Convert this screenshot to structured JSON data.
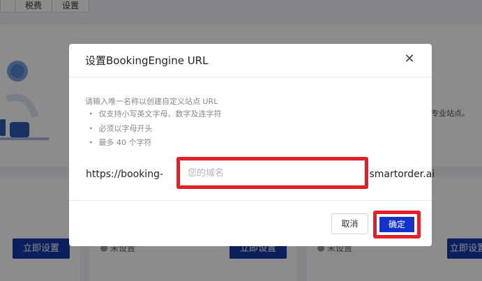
{
  "background": {
    "tabs": [
      "",
      "税费",
      "设置"
    ],
    "description_fragment": "专业站点。",
    "cards": [
      {
        "button_label": "立即设置"
      },
      {
        "status": "未设置",
        "button_label": "立即设置"
      },
      {
        "status": "未设置",
        "button_label": "立即设置"
      }
    ]
  },
  "dialog": {
    "title": "设置BookingEngine URL",
    "close_icon": "✕",
    "hint": "请输入唯一名称以创建自定义站点 URL",
    "rules": [
      "仅支持小写英文字母、数字及连字符",
      "必须以字母开头",
      "最多 40 个字符"
    ],
    "url_prefix": "https://booking-",
    "url_suffix": ".smartorder.ai",
    "domain_value": "",
    "domain_placeholder": "您的域名",
    "cancel_label": "取消",
    "confirm_label": "确定"
  },
  "colors": {
    "primary": "#1332c9",
    "highlight": "#e32027",
    "overlay": "rgba(0,0,0,0.45)"
  }
}
